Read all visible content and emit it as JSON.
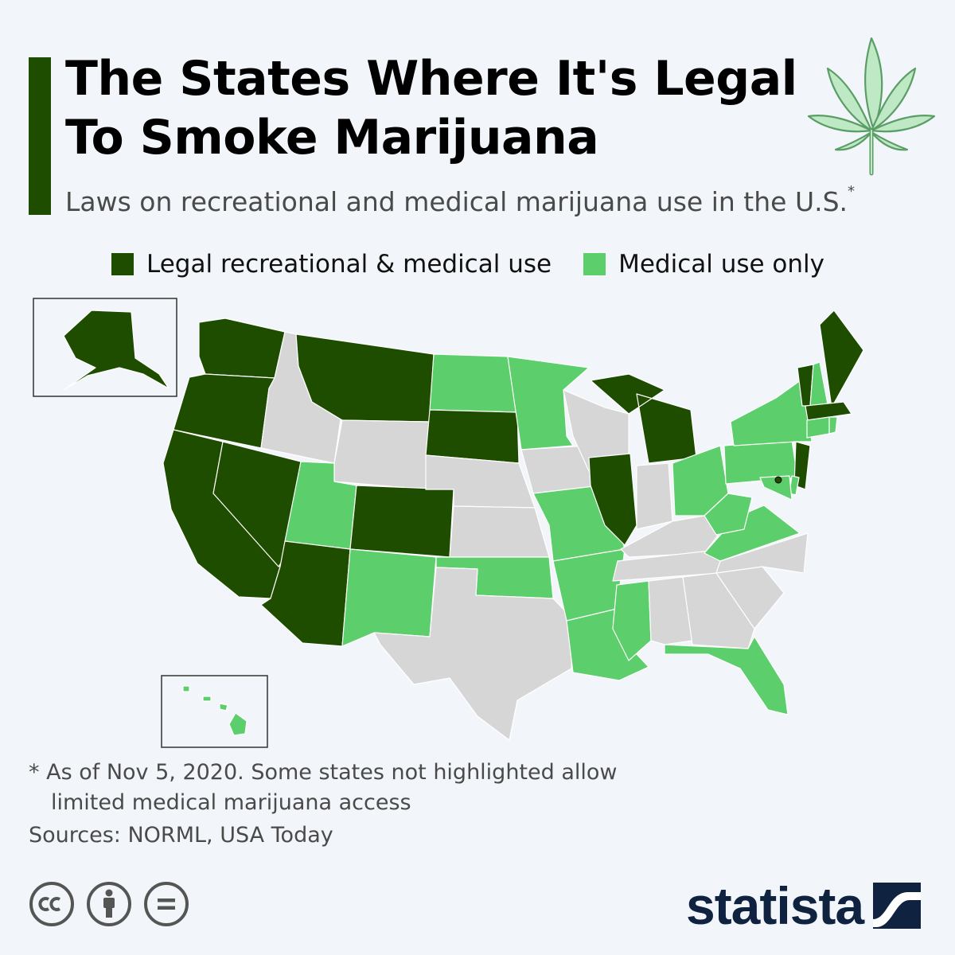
{
  "title": "The States Where It's Legal To Smoke Marijuana",
  "subtitle": "Laws on recreational and medical marijuana use in the U.S.",
  "subtitle_marker": "*",
  "colors": {
    "recreational": "#1e4d00",
    "medical": "#5ccf6c",
    "none": "#d6d6d6",
    "accent": "#1e4d00",
    "leaf": "#bfe8c5"
  },
  "legend": [
    {
      "label": "Legal recreational & medical use",
      "status": "recreational"
    },
    {
      "label": "Medical use only",
      "status": "medical"
    }
  ],
  "states": {
    "AK": "recreational",
    "WA": "recreational",
    "OR": "recreational",
    "CA": "recreational",
    "NV": "recreational",
    "AZ": "recreational",
    "MT": "recreational",
    "SD": "recreational",
    "CO": "recreational",
    "IL": "recreational",
    "MI": "recreational",
    "ME": "recreational",
    "VT": "recreational",
    "MA": "recreational",
    "NJ": "recreational",
    "DC": "recreational",
    "HI": "medical",
    "UT": "medical",
    "NM": "medical",
    "ND": "medical",
    "MN": "medical",
    "MO": "medical",
    "OK": "medical",
    "AR": "medical",
    "LA": "medical",
    "MS": "medical",
    "FL": "medical",
    "OH": "medical",
    "PA": "medical",
    "WV": "medical",
    "VA": "medical",
    "MD": "medical",
    "DE": "medical",
    "NY": "medical",
    "NH": "medical",
    "CT": "medical",
    "RI": "medical",
    "ID": "none",
    "WY": "none",
    "NE": "none",
    "KS": "none",
    "TX": "none",
    "IA": "none",
    "WI": "none",
    "IN": "none",
    "KY": "none",
    "TN": "none",
    "AL": "none",
    "GA": "none",
    "SC": "none",
    "NC": "none"
  },
  "footnote": {
    "marker": "*",
    "line1": "As of Nov 5, 2020. Some states not highlighted allow",
    "line2": "limited medical marijuana access"
  },
  "sources": "Sources: NORML, USA Today",
  "license_icons": [
    "creative-commons-icon",
    "attribution-icon",
    "no-derivatives-icon"
  ],
  "brand": "statista"
}
